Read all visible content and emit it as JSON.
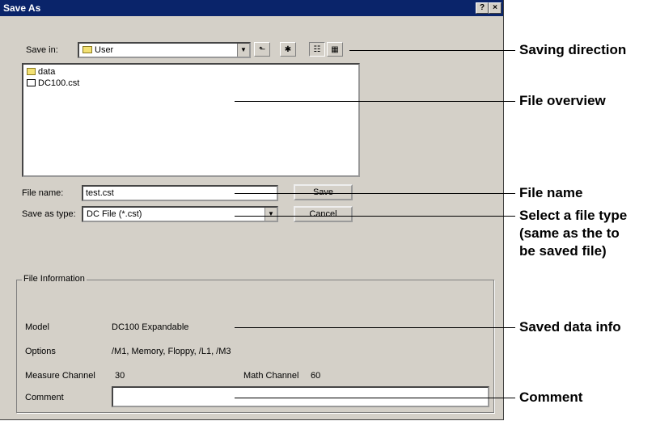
{
  "dialog": {
    "title": "Save As",
    "help_button": "?",
    "close_button": "×"
  },
  "toolbar": {
    "save_in_label": "Save in:",
    "save_in_value": "User",
    "icons": [
      "folder-icon",
      "up-one-level-icon",
      "new-folder-icon",
      "list-view-icon",
      "details-view-icon"
    ]
  },
  "file_list": {
    "items": [
      {
        "name": "data",
        "icon": "folder-icon"
      },
      {
        "name": "DC100.cst",
        "icon": "document-icon"
      }
    ]
  },
  "form": {
    "file_name_label": "File name:",
    "file_name_value": "test.cst",
    "save_as_type_label": "Save as type:",
    "save_as_type_value": "DC File (*.cst)",
    "save_button": "Save",
    "cancel_button": "Cancel"
  },
  "file_info": {
    "group_title": "File Information",
    "model_label": "Model",
    "model_value": "DC100 Expandable",
    "options_label": "Options",
    "options_value": "/M1, Memory, Floppy, /L1, /M3",
    "measure_channel_label": "Measure Channel",
    "measure_channel_value": "30",
    "math_channel_label": "Math Channel",
    "math_channel_value": "60",
    "comment_label": "Comment",
    "comment_value": ""
  },
  "callouts": {
    "saving_direction": "Saving direction",
    "file_overview": "File overview",
    "file_name": "File name",
    "file_type_line1": "Select a file type",
    "file_type_line2": "(same as the to",
    "file_type_line3": "be saved file)",
    "saved_data_info": "Saved data info",
    "comment": "Comment"
  }
}
